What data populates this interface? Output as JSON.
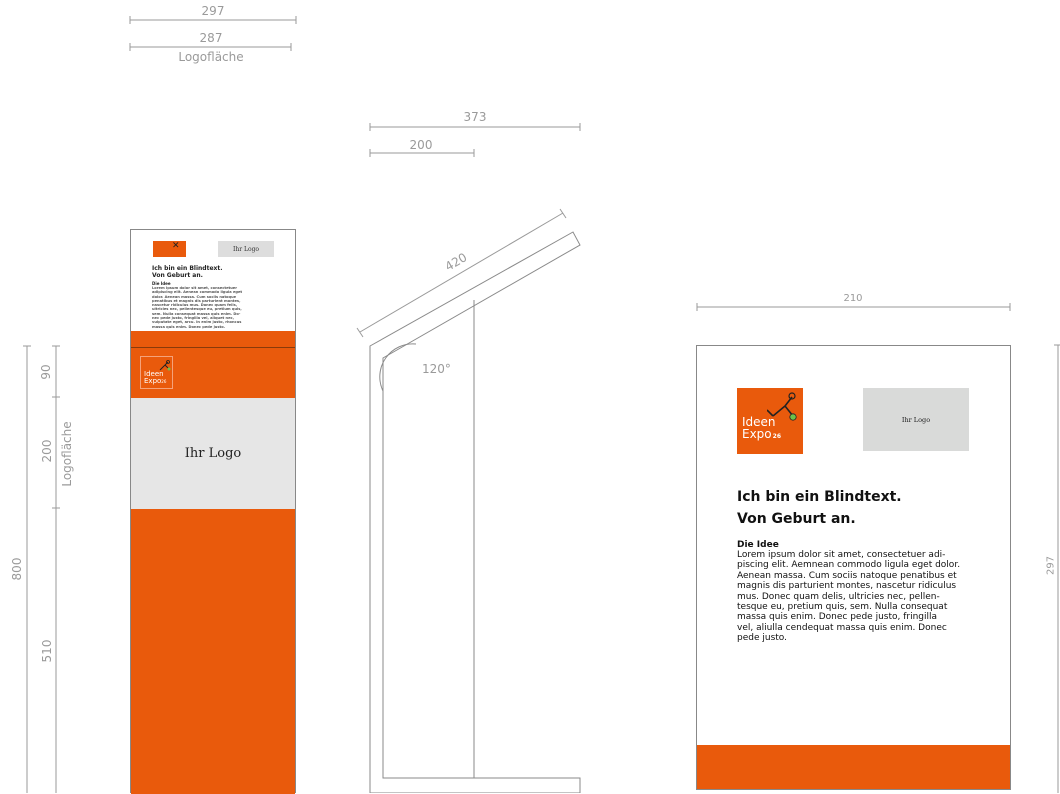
{
  "colors": {
    "accent": "#e95a0c",
    "logo_placeholder": "#e6e6e6",
    "line": "#9a9a9a"
  },
  "top_dims": {
    "width_total": "297",
    "width_logo": "287",
    "logo_area_label": "Logofläche"
  },
  "left_vertical_dims": {
    "total": "800",
    "top": "90",
    "logo": "200",
    "logo_label": "Logofläche",
    "bottom": "510"
  },
  "side_view": {
    "top_total": "373",
    "top_inner": "200",
    "slope": "420",
    "angle": "120°"
  },
  "panel": {
    "width_dim": "210",
    "height_dim": "297",
    "logo_line1": "Ideen",
    "logo_line2": "Expo",
    "logo_suffix": "26",
    "placeholder_label": "Ihr Logo",
    "headline_line1": "Ich bin ein Blindtext.",
    "headline_line2": "Von Geburt an.",
    "section_title": "Die Idee",
    "body_lines": [
      "Lorem ipsum dolor sit amet, consectetuer adi-",
      "piscing elit. Aemnean commodo ligula eget dolor.",
      "Aenean massa. Cum sociis natoque penatibus et",
      "magnis dis parturient montes, nascetur ridiculus",
      "mus. Donec quam delis, ultricies nec, pellen-",
      "tesque eu, pretium quis, sem. Nulla consequat",
      "massa quis enim. Donec pede justo, fringilla",
      "vel, aliulla cendequat massa quis enim. Donec",
      "pede justo."
    ]
  },
  "stand": {
    "placeholder_label": "Ihr Logo",
    "mini_placeholder_label": "Ihr Logo",
    "mini_headline_line1": "Ich bin ein Blindtext.",
    "mini_headline_line2": "Von Geburt an.",
    "mini_section_title": "Die Idee",
    "mini_body_lines": [
      "Lorem ipsum dolor sit amet, consectetuer",
      "adipiscing elit. Aenean commodo ligula eget",
      "dolor. Aenean massa. Cum sociis natoque",
      "penatibus et magnis dis parturient montes,",
      "nascetur ridiculus mus. Donec quam felis,",
      "ultricies nec, pellentesque eu, pretium quis,",
      "sem. Nulla consequat massa quis enim. Do-",
      "nec pede justo, fringilla vel, aliquet nec,",
      "vulputate eget, arcu. In enim justo, rhoncus",
      "massa quis enim. Donec pede justo."
    ],
    "logo_line1": "Ideen",
    "logo_line2": "Expo",
    "logo_suffix": "26"
  }
}
